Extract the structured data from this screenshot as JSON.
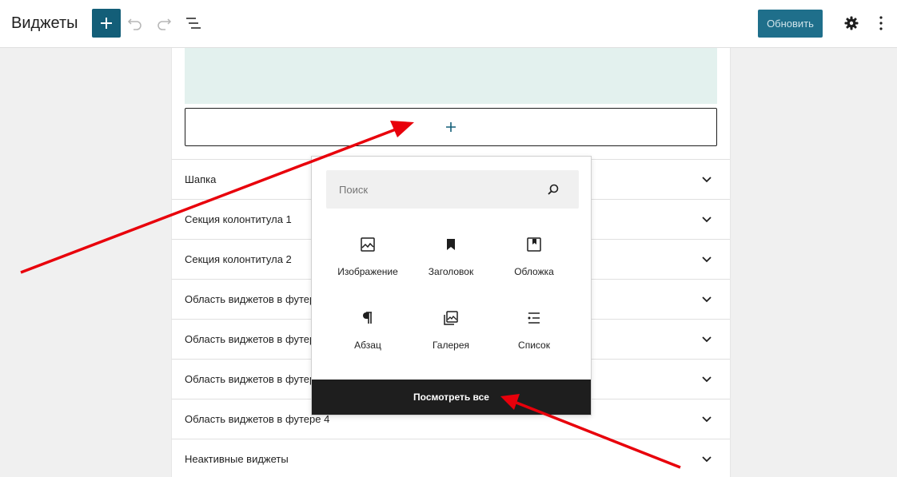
{
  "header": {
    "title": "Виджеты",
    "update_label": "Обновить"
  },
  "colors": {
    "accent": "#135e78",
    "update_bg": "#1f6f8b",
    "mint_block": "#e3f1ee",
    "annotation_arrow": "#e8000b"
  },
  "widget_areas": [
    {
      "label": "Шапка"
    },
    {
      "label": "Секция колонтитула 1"
    },
    {
      "label": "Секция колонтитула 2"
    },
    {
      "label": "Область виджетов в футере 1"
    },
    {
      "label": "Область виджетов в футере 2"
    },
    {
      "label": "Область виджетов в футере 3"
    },
    {
      "label": "Область виджетов в футере 4"
    },
    {
      "label": "Неактивные виджеты"
    }
  ],
  "inserter": {
    "search_placeholder": "Поиск",
    "blocks": [
      {
        "label": "Изображение",
        "icon": "image-icon"
      },
      {
        "label": "Заголовок",
        "icon": "bookmark-icon"
      },
      {
        "label": "Обложка",
        "icon": "cover-icon"
      },
      {
        "label": "Абзац",
        "icon": "paragraph-icon"
      },
      {
        "label": "Галерея",
        "icon": "gallery-icon"
      },
      {
        "label": "Список",
        "icon": "list-icon"
      }
    ],
    "browse_all_label": "Посмотреть все"
  }
}
